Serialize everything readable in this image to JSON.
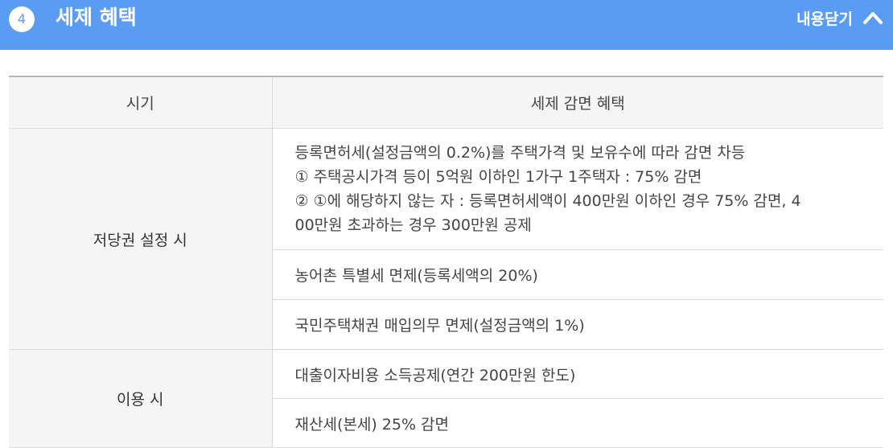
{
  "header": {
    "step_number": "4",
    "title": "세제 혜택",
    "collapse_label": "내용닫기",
    "colors": {
      "bar": "#5a9cf3",
      "text": "#ffffff"
    }
  },
  "table": {
    "columns": [
      "시기",
      "세제 감면 혜택"
    ],
    "groups": [
      {
        "period": "저당권 설정 시",
        "benefits": [
          {
            "lines": [
              "등록면허세(설정금액의 0.2%)를 주택가격 및 보유수에 따라 감면 차등",
              "① 주택공시가격 등이 5억원 이하인 1가구 1주택자 : 75% 감면",
              "② ①에 해당하지 않는 자 : 등록면허세액이 400만원 이하인 경우 75% 감면, 4",
              "00만원 초과하는 경우 300만원 공제"
            ]
          },
          {
            "lines": [
              "농어촌 특별세 면제(등록세액의 20%)"
            ]
          },
          {
            "lines": [
              "국민주택채권 매입의무 면제(설정금액의 1%)"
            ]
          }
        ]
      },
      {
        "period": "이용 시",
        "benefits": [
          {
            "lines": [
              "대출이자비용 소득공제(연간 200만원 한도)"
            ]
          },
          {
            "lines": [
              "재산세(본세) 25% 감면"
            ]
          }
        ]
      }
    ]
  }
}
